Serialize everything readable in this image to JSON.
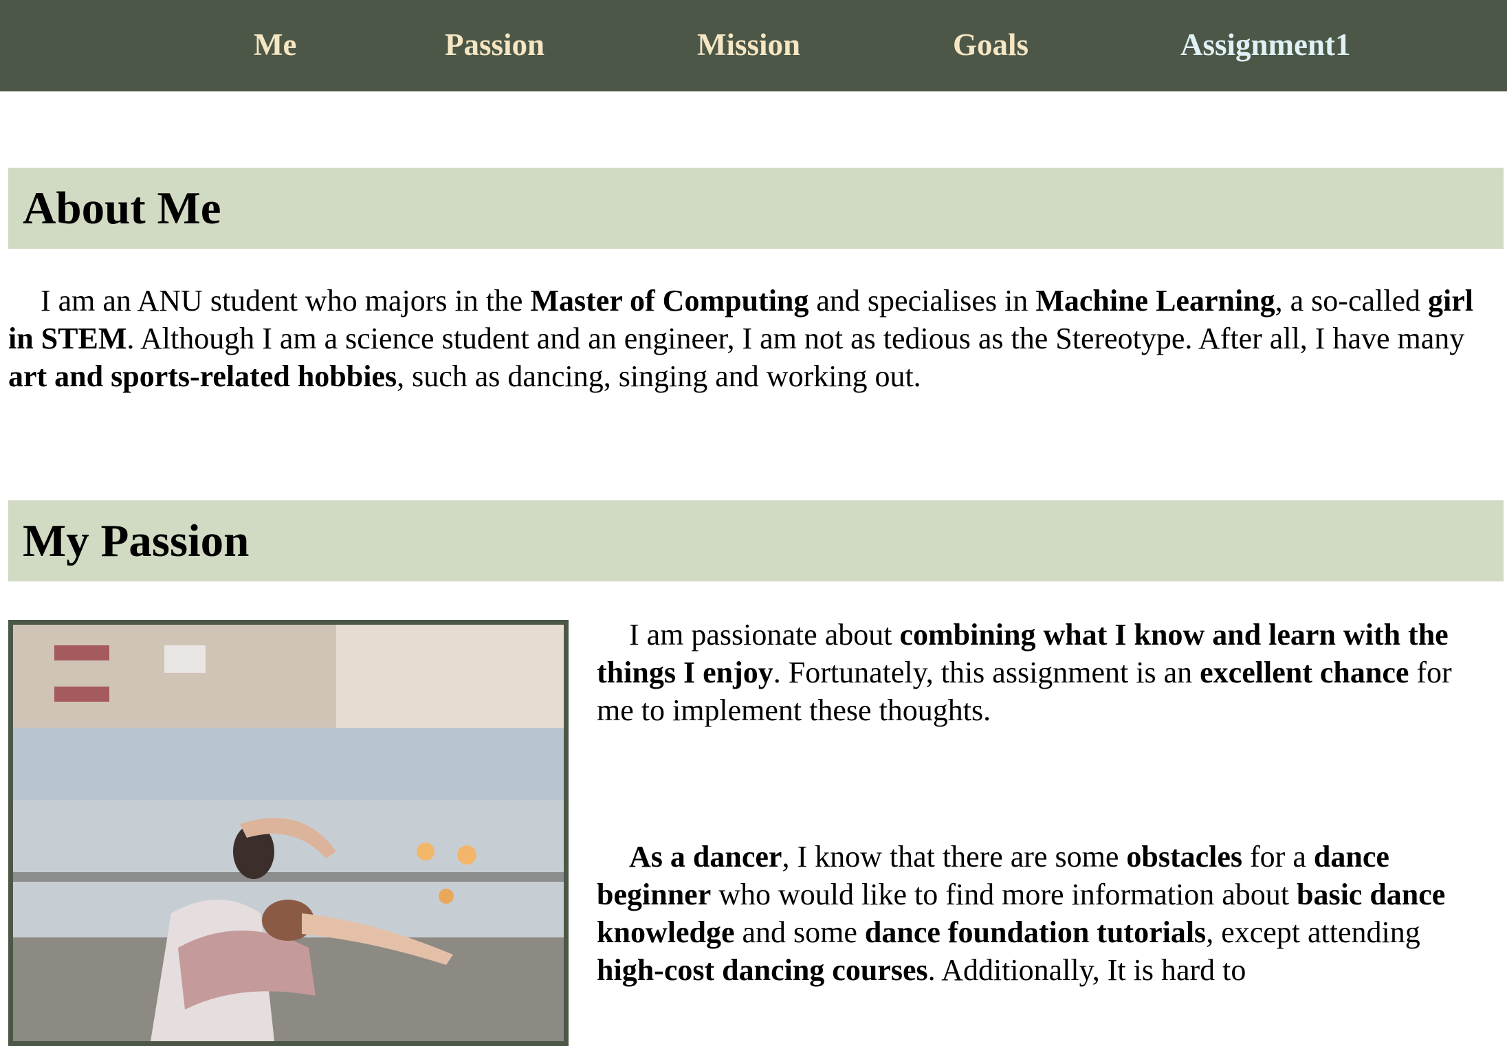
{
  "nav": {
    "items": [
      {
        "label": "Me"
      },
      {
        "label": "Passion"
      },
      {
        "label": "Mission"
      },
      {
        "label": "Goals"
      },
      {
        "label": "Assignment1"
      }
    ]
  },
  "about": {
    "title": "About Me",
    "p1": {
      "t1": "I am an ANU student who majors in the ",
      "b1": "Master of Computing",
      "t2": " and specialises in ",
      "b2": "Machine Learning",
      "t3": ", a so-called ",
      "b3": "girl in STEM",
      "t4": ". Although I am a science student and an engineer, I am not as tedious as the Stereotype. After all, I have many ",
      "b4": "art and sports-related hobbies",
      "t5": ", such as dancing, singing and working out."
    }
  },
  "passion": {
    "title": "My Passion",
    "p1": {
      "t1": "I am passionate about ",
      "b1": "combining what I know and learn with the things I enjoy",
      "t2": ". Fortunately, this assignment is an ",
      "b2": "excellent chance",
      "t3": " for me to implement these thoughts."
    },
    "p2": {
      "b1": "As a dancer",
      "t1": ", I know that there are some ",
      "b2": "obstacles",
      "t2": " for a ",
      "b3": "dance beginner",
      "t3": " who would like to find more information about ",
      "b4": "basic dance knowledge",
      "t4": " and some ",
      "b5": "dance foundation tutorials",
      "t5": ", except attending ",
      "b6": "high-cost dancing courses",
      "t6": ". Additionally, It is hard to"
    }
  },
  "colors": {
    "nav_bg": "#4c5747",
    "nav_text": "#f5e6c4",
    "nav_text_active": "#dff1f4",
    "section_band": "#d1dac2"
  }
}
